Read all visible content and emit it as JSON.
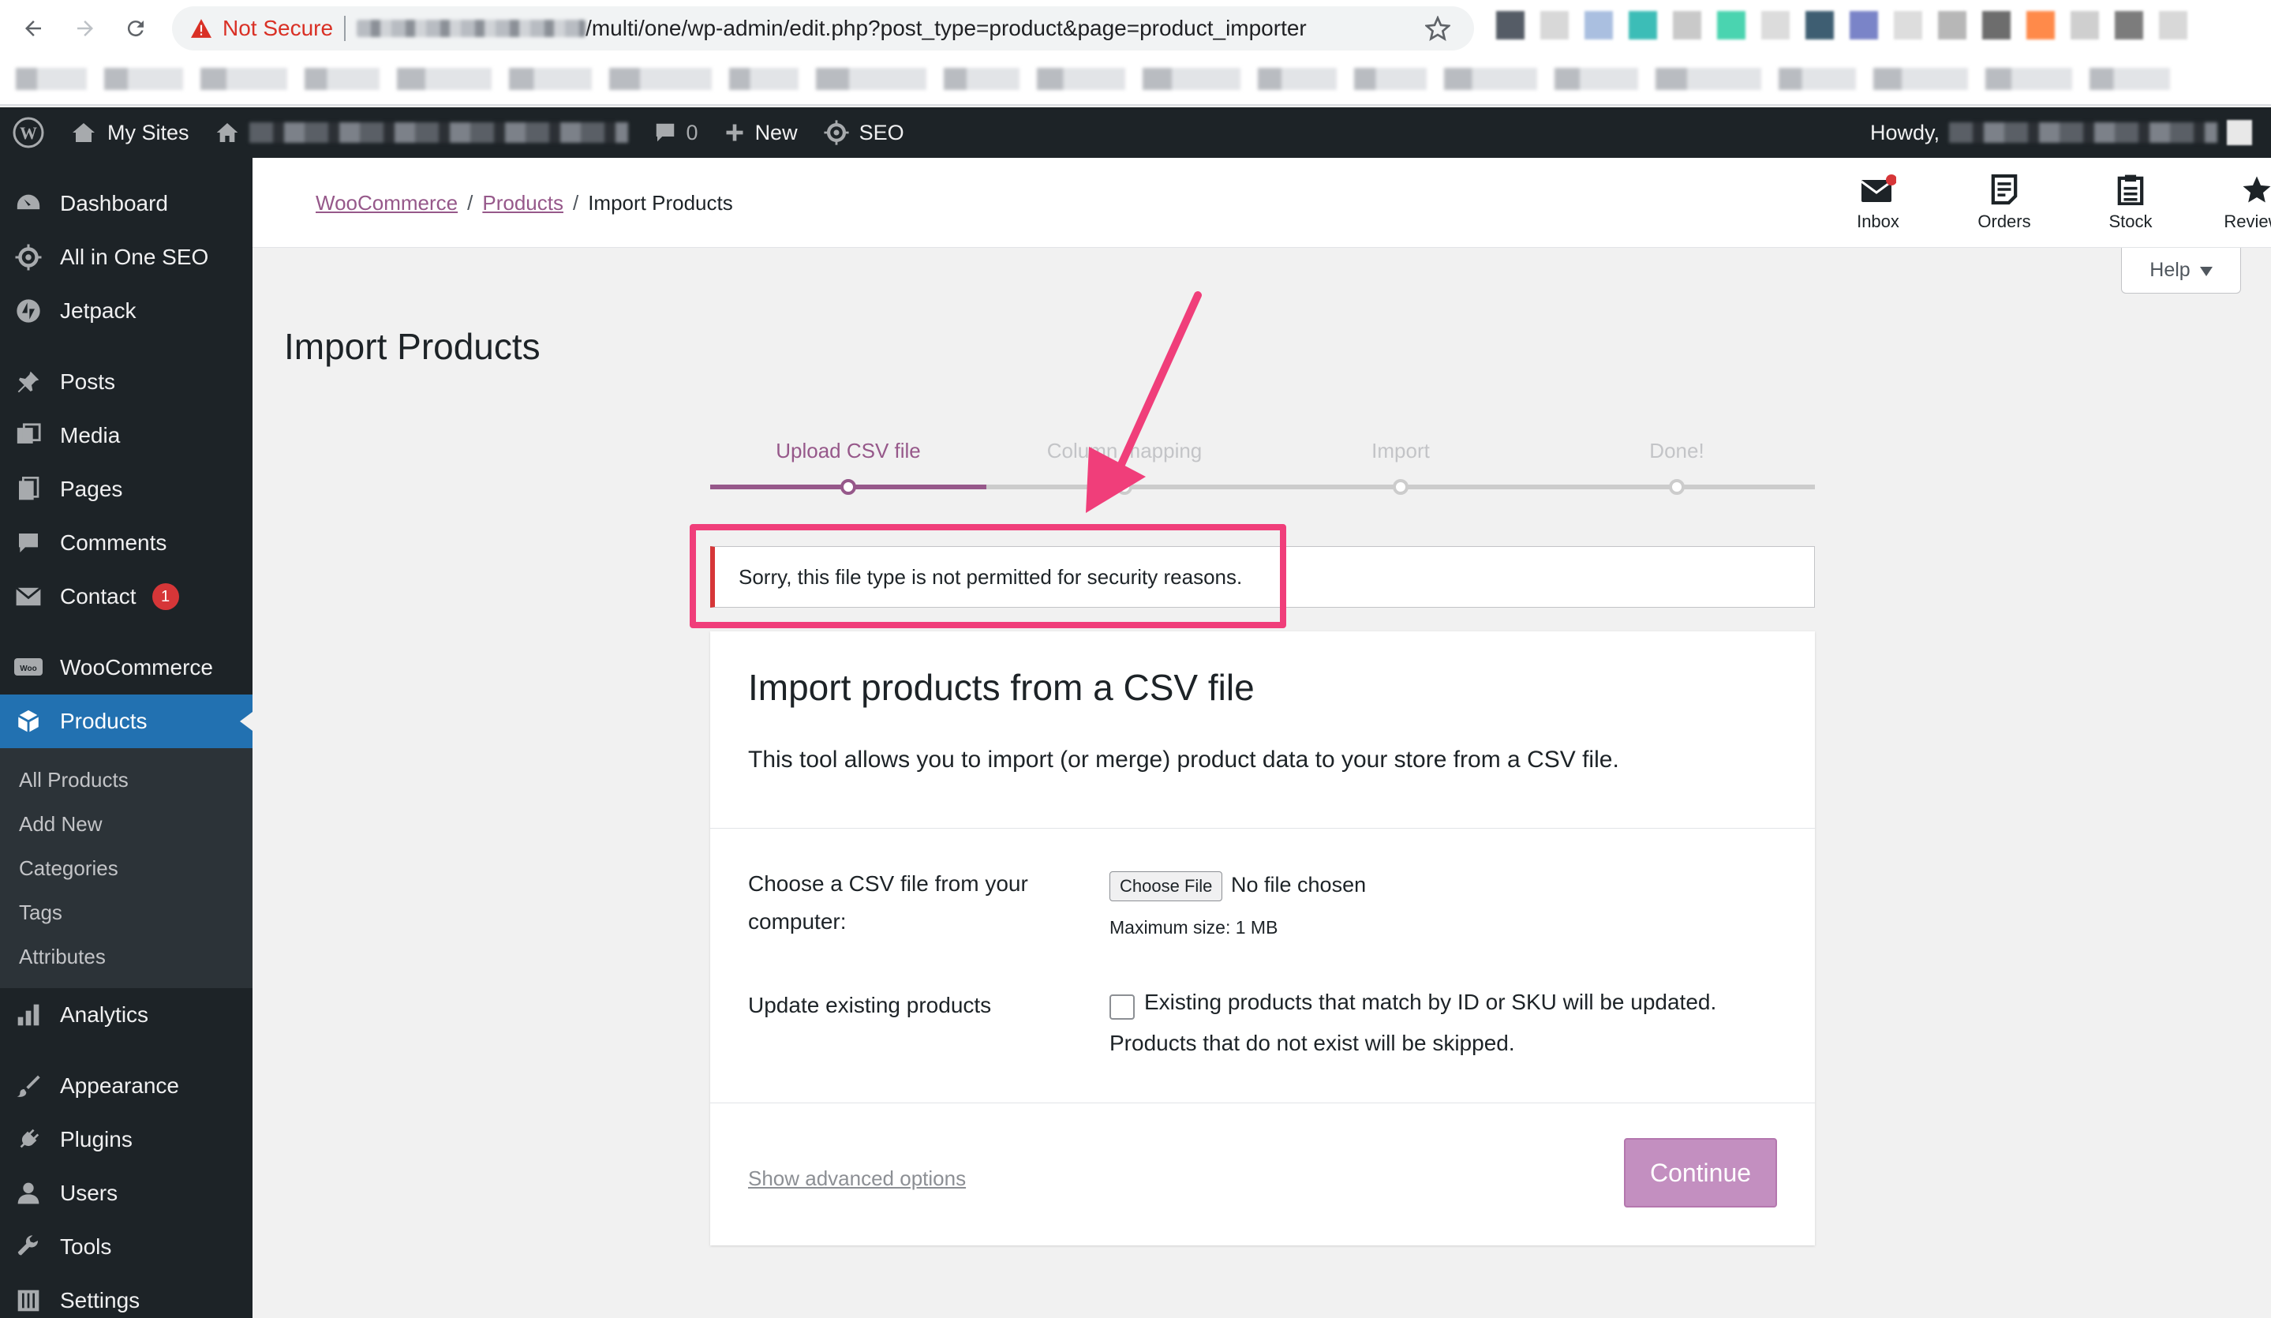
{
  "browser": {
    "security_label": "Not Secure",
    "url_path": "/multi/one/wp-admin/edit.php?post_type=product&page=product_importer",
    "ext_colors": [
      "#555c66",
      "#d8d8d8",
      "#aabfe0",
      "#3cbdb7",
      "#c9c9c9",
      "#4ad4b0",
      "#dcdcdc",
      "#3e5e72",
      "#7a84c8",
      "#dddddd",
      "#b7b7b7",
      "#6d6d6d",
      "#ff8a4a",
      "#cfcfcf",
      "#7c7c7c",
      "#d8d8d8"
    ]
  },
  "adminbar": {
    "my_sites": "My Sites",
    "comments_count": "0",
    "new_label": "New",
    "seo_label": "SEO",
    "howdy": "Howdy,"
  },
  "sidebar": {
    "dashboard": "Dashboard",
    "aioseo": "All in One SEO",
    "jetpack": "Jetpack",
    "posts": "Posts",
    "media": "Media",
    "pages": "Pages",
    "comments": "Comments",
    "contact": "Contact",
    "contact_badge": "1",
    "woocommerce": "WooCommerce",
    "products": "Products",
    "sub_all": "All Products",
    "sub_add": "Add New",
    "sub_categories": "Categories",
    "sub_tags": "Tags",
    "sub_attributes": "Attributes",
    "analytics": "Analytics",
    "appearance": "Appearance",
    "plugins": "Plugins",
    "users": "Users",
    "tools": "Tools",
    "settings": "Settings"
  },
  "header": {
    "crumb_woo": "WooCommerce",
    "crumb_products": "Products",
    "crumb_current": "Import Products",
    "inbox": "Inbox",
    "orders": "Orders",
    "stock": "Stock",
    "reviews": "Reviews",
    "help": "Help"
  },
  "page": {
    "title": "Import Products",
    "steps": [
      "Upload CSV file",
      "Column mapping",
      "Import",
      "Done!"
    ],
    "active_step": 0,
    "notice": "Sorry, this file type is not permitted for security reasons.",
    "card_title": "Import products from a CSV file",
    "card_desc": "This tool allows you to import (or merge) product data to your store from a CSV file.",
    "choose_label_1": "Choose a CSV file from your",
    "choose_label_2": "computer:",
    "choose_btn": "Choose File",
    "no_file": "No file chosen",
    "max_size": "Maximum size: 1 MB",
    "update_label": "Update existing products",
    "update_desc_1": "Existing products that match by ID or SKU will be updated.",
    "update_desc_2": "Products that do not exist will be skipped.",
    "advanced": "Show advanced options",
    "continue": "Continue"
  },
  "colors": {
    "accent": "#96588a",
    "admin_blue": "#2271b1",
    "error": "#d63638",
    "annotation": "#f03e7a"
  }
}
